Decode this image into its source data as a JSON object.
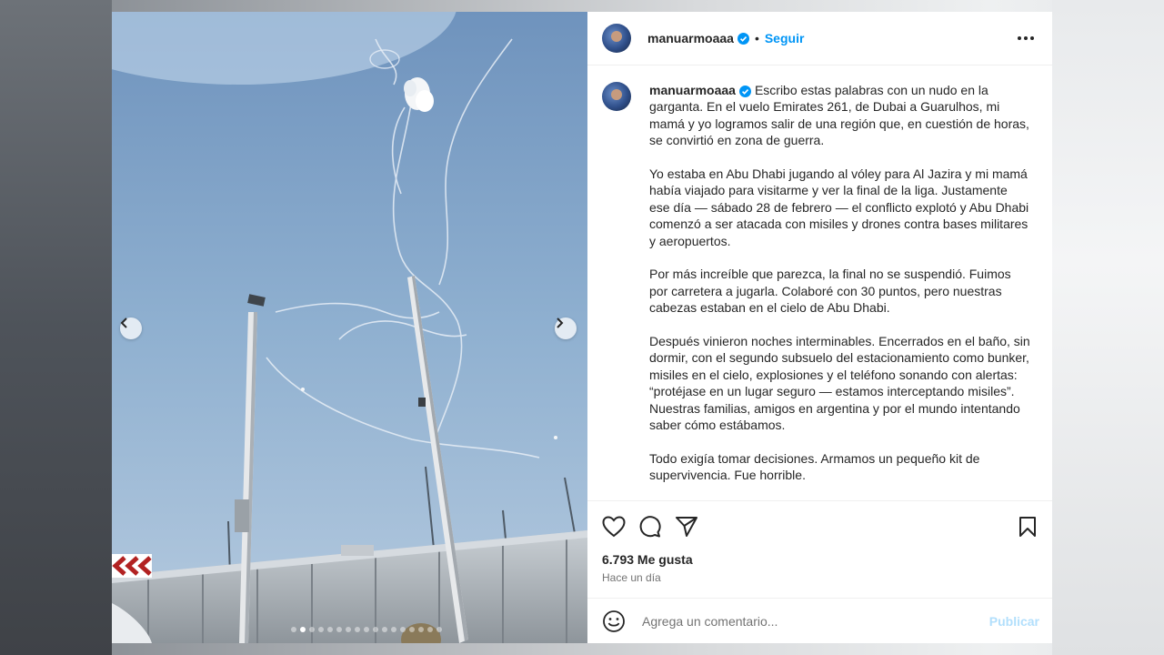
{
  "post": {
    "username": "manuarmoaaa",
    "separator": "•",
    "follow_label": "Seguir",
    "caption_paragraphs": [
      "Escribo estas palabras con un nudo en la garganta. En el vuelo Emirates 261, de Dubai a Guarulhos, mi mamá y yo logramos salir de una región que, en cuestión de horas, se convirtió en zona de guerra.",
      "Yo estaba en Abu Dhabi jugando al vóley para Al Jazira y mi mamá había viajado para visitarme y ver la final de la liga. Justamente ese día — sábado 28 de febrero — el conflicto explotó y Abu Dhabi comenzó a ser atacada con misiles y drones contra bases militares y aeropuertos.",
      "Por más increíble que parezca, la final no se suspendió. Fuimos por carretera a jugarla. Colaboré con 30 puntos, pero nuestras cabezas estaban en el cielo de Abu Dhabi.",
      "Después vinieron noches interminables. Encerrados en el baño, sin dormir, con el segundo subsuelo del estacionamiento como bunker, misiles en el cielo, explosiones y el teléfono sonando con alertas: “protéjase en un lugar seguro — estamos interceptando misiles”. Nuestras familias, amigos en argentina y por el mundo intentando saber cómo estábamos.",
      "Todo exigía tomar decisiones. Armamos un pequeño kit de supervivencia. Fue horrible."
    ],
    "likes": "6.793 Me gusta",
    "time_ago": "Hace un día",
    "comment_placeholder": "Agrega un comentario...",
    "publish_label": "Publicar"
  },
  "carousel": {
    "total_slides": 17,
    "active_slide": 2
  },
  "colors": {
    "accent_blue": "#0095f6",
    "publish_disabled": "#b2dffc",
    "verified": "#0095f6"
  },
  "icons": [
    "heart-icon",
    "comment-icon",
    "share-icon",
    "bookmark-icon",
    "emoji-icon",
    "more-icon",
    "verified-icon",
    "chevron-left-icon",
    "chevron-right-icon"
  ]
}
